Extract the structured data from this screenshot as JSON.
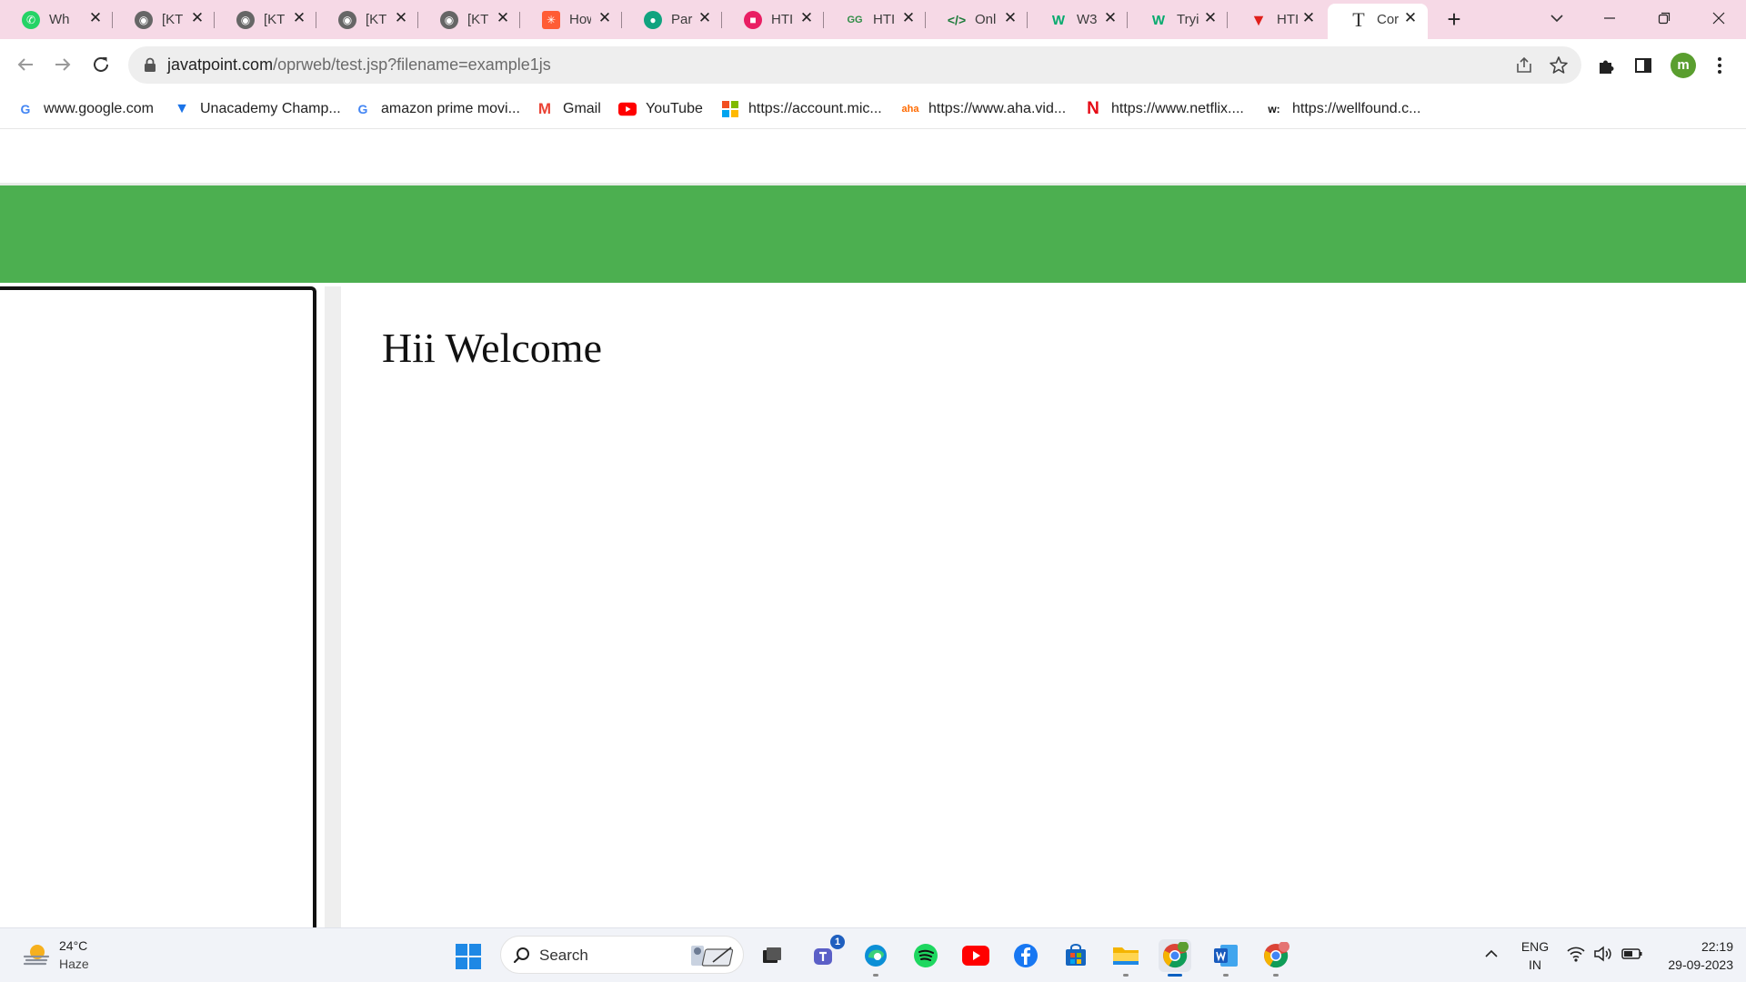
{
  "browser": {
    "tabs": [
      {
        "title": "Wh",
        "icon": "whatsapp-icon",
        "color": "#25d366"
      },
      {
        "title": "[KT",
        "icon": "globe-icon",
        "color": "#666666"
      },
      {
        "title": "[KT",
        "icon": "globe-icon",
        "color": "#666666"
      },
      {
        "title": "[KT",
        "icon": "globe-icon",
        "color": "#666666"
      },
      {
        "title": "[KT",
        "icon": "globe-icon",
        "color": "#666666"
      },
      {
        "title": "How",
        "icon": "hubspot-icon",
        "color": "#ff5c35"
      },
      {
        "title": "Par",
        "icon": "robot-icon",
        "color": "#10a37f"
      },
      {
        "title": "HTI",
        "icon": "cube-icon",
        "color": "#e91e63"
      },
      {
        "title": "HTI",
        "icon": "gfg-icon",
        "color": "#2f8d46"
      },
      {
        "title": "Onl",
        "icon": "code-icon",
        "color": "#1e7b3b"
      },
      {
        "title": "W3",
        "icon": "w3schools-icon",
        "color": "#04aa6d"
      },
      {
        "title": "Tryi",
        "icon": "w3schools-icon",
        "color": "#04aa6d"
      },
      {
        "title": "HTI",
        "icon": "tutorialspoint-icon",
        "color": "#e0201c"
      },
      {
        "title": "Cor",
        "icon": "text-t-icon",
        "color": "#444444",
        "active": true
      }
    ],
    "address_host": "javatpoint.com",
    "address_rest": "/oprweb/test.jsp?filename=example1js",
    "profile_initial": "m",
    "bookmarks": [
      {
        "label": "www.google.com",
        "icon": "google-icon"
      },
      {
        "label": "Unacademy Champ...",
        "icon": "unacademy-icon"
      },
      {
        "label": "amazon prime movi...",
        "icon": "google-icon"
      },
      {
        "label": "Gmail",
        "icon": "gmail-icon"
      },
      {
        "label": "YouTube",
        "icon": "youtube-icon"
      },
      {
        "label": "https://account.mic...",
        "icon": "microsoft-icon"
      },
      {
        "label": "https://www.aha.vid...",
        "icon": "aha-icon"
      },
      {
        "label": "https://www.netflix....",
        "icon": "netflix-icon"
      },
      {
        "label": "https://wellfound.c...",
        "icon": "wellfound-icon"
      }
    ]
  },
  "page": {
    "heading": "Hii Welcome",
    "band_color": "#4caf50"
  },
  "taskbar": {
    "weather_temp": "24°C",
    "weather_desc": "Haze",
    "search_label": "Search",
    "teams_badge": "1",
    "lang_top": "ENG",
    "lang_bottom": "IN",
    "time": "22:19",
    "date": "29-09-2023"
  }
}
